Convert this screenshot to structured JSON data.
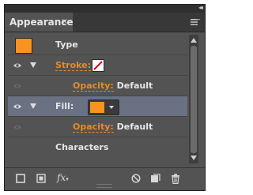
{
  "panel": {
    "tab_label": "Appearance",
    "close_glyph": "×",
    "collapse_glyph": "◂◂",
    "menu_icon": "panel-menu-icon"
  },
  "rows": {
    "type": {
      "label": "Type"
    },
    "stroke": {
      "label": "Stroke:",
      "swatch": "none-swatch"
    },
    "stroke_opacity": {
      "label": "Opacity:",
      "value": "Default"
    },
    "fill": {
      "label": "Fill:",
      "swatch_color": "#f7931e"
    },
    "fill_opacity": {
      "label": "Opacity:",
      "value": "Default"
    },
    "characters": {
      "label": "Characters"
    }
  },
  "bottom": {
    "fx_label": "fx"
  },
  "colors": {
    "panel_bg": "#535353",
    "selected_row": "#6a7182",
    "link": "#e48a2a",
    "fill_swatch": "#f7931e",
    "none_slash": "#d0021b"
  }
}
